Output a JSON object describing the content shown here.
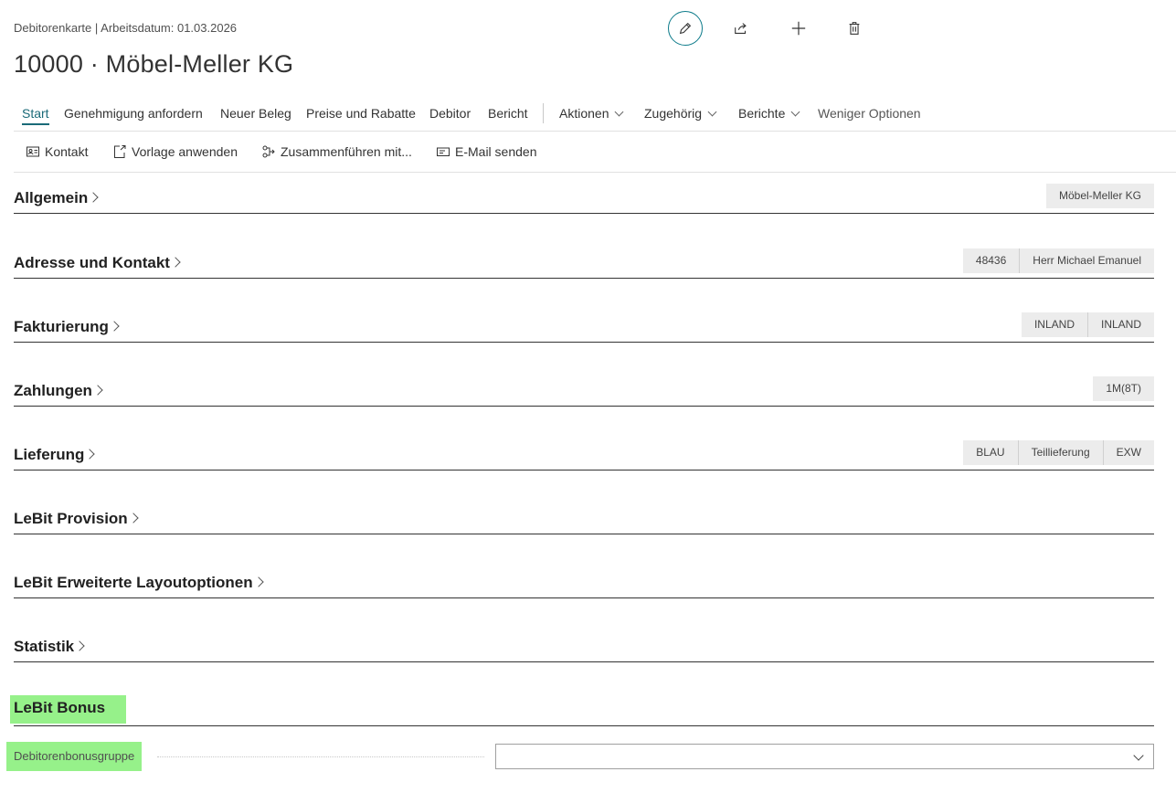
{
  "header": {
    "breadcrumb": "Debitorenkarte | Arbeitsdatum: 01.03.2026",
    "title": "10000 · Möbel-Meller KG",
    "actions": [
      "edit-icon",
      "share-icon",
      "plus-icon",
      "delete-icon"
    ]
  },
  "menu": {
    "items": [
      "Start",
      "Genehmigung anfordern",
      "Neuer Beleg",
      "Preise und Rabatte",
      "Debitor",
      "Bericht"
    ],
    "dropdowns": [
      "Aktionen",
      "Zugehörig",
      "Berichte"
    ],
    "less": "Weniger Optionen"
  },
  "subbar": {
    "items": [
      "Kontakt",
      "Vorlage anwenden",
      "Zusammenführen mit...",
      "E-Mail senden"
    ],
    "icons": [
      "contact-icon",
      "template-icon",
      "merge-icon",
      "email-icon"
    ]
  },
  "sections": [
    {
      "title": "Allgemein",
      "badges": [
        "Möbel-Meller KG"
      ]
    },
    {
      "title": "Adresse und Kontakt",
      "badges": [
        "48436",
        "Herr Michael Emanuel"
      ]
    },
    {
      "title": "Fakturierung",
      "badges": [
        "INLAND",
        "INLAND"
      ]
    },
    {
      "title": "Zahlungen",
      "badges": [
        "1M(8T)"
      ]
    },
    {
      "title": "Lieferung",
      "badges": [
        "BLAU",
        "Teillieferung",
        "EXW"
      ]
    },
    {
      "title": "LeBit Provision",
      "badges": []
    },
    {
      "title": "LeBit Erweiterte Layoutoptionen",
      "badges": []
    },
    {
      "title": "Statistik",
      "badges": []
    }
  ],
  "bonus": {
    "title": "LeBit Bonus",
    "field_label": "Debitorenbonusgruppe",
    "field_value": "",
    "highlight_color": "#96f18a"
  },
  "colors": {
    "accent": "#1a6a78"
  }
}
